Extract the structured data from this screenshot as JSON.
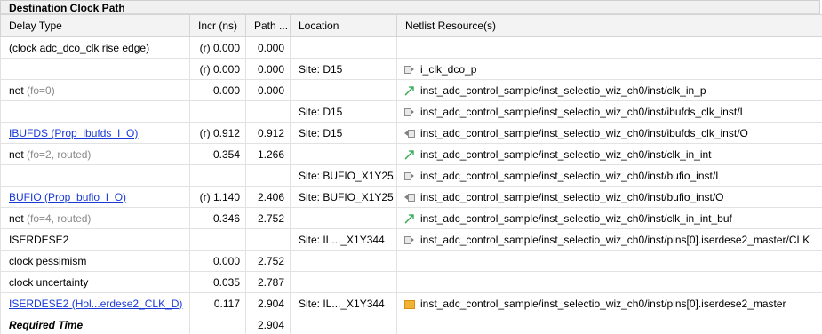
{
  "section": {
    "title": "Destination Clock Path"
  },
  "columns": [
    "Delay Type",
    "Incr (ns)",
    "Path ...",
    "Location",
    "Netlist Resource(s)"
  ],
  "rows": [
    {
      "delay_type": "(clock adc_dco_clk rise edge)",
      "delay_type_extra": "",
      "style": "plain",
      "incr": "(r) 0.000",
      "path": "0.000",
      "location": "",
      "resource": "",
      "resource_icon": ""
    },
    {
      "delay_type": "",
      "delay_type_extra": "",
      "style": "plain",
      "incr": "(r) 0.000",
      "path": "0.000",
      "location": "Site: D15",
      "resource": "i_clk_dco_p",
      "resource_icon": "pin-in-icon"
    },
    {
      "delay_type": "net",
      "delay_type_extra": "(fo=0)",
      "style": "plain",
      "incr": "0.000",
      "path": "0.000",
      "location": "",
      "resource": "inst_adc_control_sample/inst_selectio_wiz_ch0/inst/clk_in_p",
      "resource_icon": "net-icon"
    },
    {
      "delay_type": "",
      "delay_type_extra": "",
      "style": "plain",
      "incr": "",
      "path": "",
      "location": "Site: D15",
      "resource": "inst_adc_control_sample/inst_selectio_wiz_ch0/inst/ibufds_clk_inst/I",
      "resource_icon": "pin-in-icon"
    },
    {
      "delay_type": "IBUFDS (Prop_ibufds_I_O)",
      "delay_type_extra": "",
      "style": "link",
      "incr": "(r) 0.912",
      "path": "0.912",
      "location": "Site: D15",
      "resource": "inst_adc_control_sample/inst_selectio_wiz_ch0/inst/ibufds_clk_inst/O",
      "resource_icon": "pin-out-icon"
    },
    {
      "delay_type": "net",
      "delay_type_extra": "(fo=2, routed)",
      "style": "plain",
      "incr": "0.354",
      "path": "1.266",
      "location": "",
      "resource": "inst_adc_control_sample/inst_selectio_wiz_ch0/inst/clk_in_int",
      "resource_icon": "net-icon"
    },
    {
      "delay_type": "",
      "delay_type_extra": "",
      "style": "plain",
      "incr": "",
      "path": "",
      "location": "Site: BUFIO_X1Y25",
      "resource": "inst_adc_control_sample/inst_selectio_wiz_ch0/inst/bufio_inst/I",
      "resource_icon": "pin-in-icon"
    },
    {
      "delay_type": "BUFIO (Prop_bufio_I_O)",
      "delay_type_extra": "",
      "style": "link",
      "incr": "(r) 1.140",
      "path": "2.406",
      "location": "Site: BUFIO_X1Y25",
      "resource": "inst_adc_control_sample/inst_selectio_wiz_ch0/inst/bufio_inst/O",
      "resource_icon": "pin-out-icon"
    },
    {
      "delay_type": "net",
      "delay_type_extra": "(fo=4, routed)",
      "style": "plain",
      "incr": "0.346",
      "path": "2.752",
      "location": "",
      "resource": "inst_adc_control_sample/inst_selectio_wiz_ch0/inst/clk_in_int_buf",
      "resource_icon": "net-icon"
    },
    {
      "delay_type": "ISERDESE2",
      "delay_type_extra": "",
      "style": "plain",
      "incr": "",
      "path": "",
      "location": "Site: IL..._X1Y344",
      "resource": "inst_adc_control_sample/inst_selectio_wiz_ch0/inst/pins[0].iserdese2_master/CLK",
      "resource_icon": "pin-in-icon"
    },
    {
      "delay_type": "clock pessimism",
      "delay_type_extra": "",
      "style": "plain",
      "incr": "0.000",
      "path": "2.752",
      "location": "",
      "resource": "",
      "resource_icon": ""
    },
    {
      "delay_type": "clock uncertainty",
      "delay_type_extra": "",
      "style": "plain",
      "incr": "0.035",
      "path": "2.787",
      "location": "",
      "resource": "",
      "resource_icon": ""
    },
    {
      "delay_type": "ISERDESE2 (Hol...erdese2_CLK_D)",
      "delay_type_extra": "",
      "style": "link",
      "incr": "0.117",
      "path": "2.904",
      "location": "Site: IL..._X1Y344",
      "resource": "inst_adc_control_sample/inst_selectio_wiz_ch0/inst/pins[0].iserdese2_master",
      "resource_icon": "cell-icon"
    },
    {
      "delay_type": "Required Time",
      "delay_type_extra": "",
      "style": "bold-italic",
      "incr": "",
      "path": "2.904",
      "location": "",
      "resource": "",
      "resource_icon": ""
    }
  ],
  "colors": {
    "link": "#1a3ad6",
    "net_arrow": "#2aa84a",
    "cell": "#f2b233",
    "header_bg": "#f3f3f3"
  }
}
